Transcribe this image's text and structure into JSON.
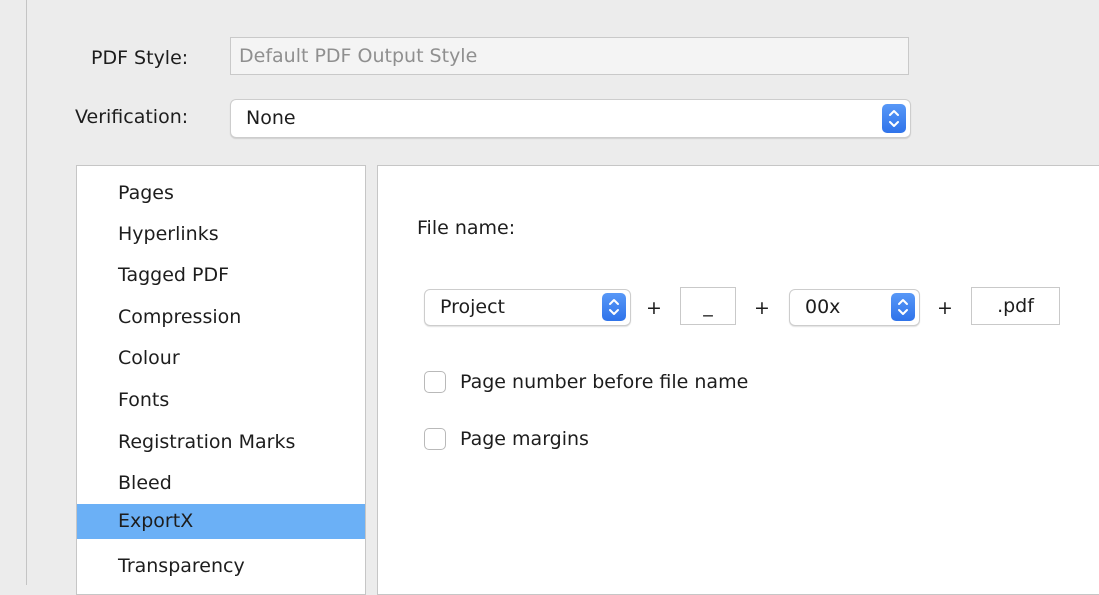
{
  "pdf_style": {
    "label": "PDF Style:",
    "placeholder": "Default PDF Output Style"
  },
  "verification": {
    "label": "Verification:",
    "value": "None"
  },
  "sidebar": {
    "items": [
      {
        "label": "Pages",
        "selected": false
      },
      {
        "label": "Hyperlinks",
        "selected": false
      },
      {
        "label": "Tagged PDF",
        "selected": false
      },
      {
        "label": "Compression",
        "selected": false
      },
      {
        "label": "Colour",
        "selected": false
      },
      {
        "label": "Fonts",
        "selected": false
      },
      {
        "label": "Registration Marks",
        "selected": false
      },
      {
        "label": "Bleed",
        "selected": false
      },
      {
        "label": "ExportX",
        "selected": true
      },
      {
        "label": "Transparency",
        "selected": false
      }
    ]
  },
  "export": {
    "file_name_label": "File name:",
    "name_source": "Project",
    "plus_1": "+",
    "separator": "_",
    "plus_2": "+",
    "number_format": "00x",
    "plus_3": "+",
    "extension": ".pdf",
    "page_number_before": {
      "label": "Page number before file name",
      "checked": false
    },
    "page_margins": {
      "label": "Page margins",
      "checked": false
    }
  },
  "colors": {
    "selection": "#6bb0f6",
    "stepper_blue": "#2f73ea",
    "window_bg": "#ececec"
  }
}
